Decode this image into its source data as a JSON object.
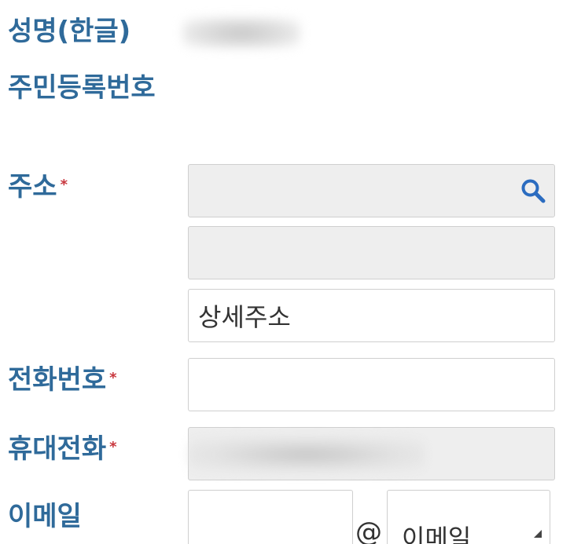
{
  "form": {
    "name_ko": {
      "label": "성명(한글)"
    },
    "resident_no": {
      "label": "주민등록번호"
    },
    "address": {
      "label": "주소",
      "required_mark": "*",
      "detail_placeholder": "상세주소"
    },
    "phone": {
      "label": "전화번호",
      "required_mark": "*"
    },
    "mobile": {
      "label": "휴대전화",
      "required_mark": "*"
    },
    "email": {
      "label": "이메일",
      "at_symbol": "@",
      "domain_select": "이메일"
    }
  },
  "colors": {
    "label": "#2f6a9a",
    "required": "#c8363d",
    "search_icon": "#2b6cc0",
    "readonly_bg": "#eeeeee",
    "border": "#cfcfcf"
  },
  "icons": {
    "address_search": "search-icon",
    "email_select": "dropdown-arrow-icon"
  }
}
